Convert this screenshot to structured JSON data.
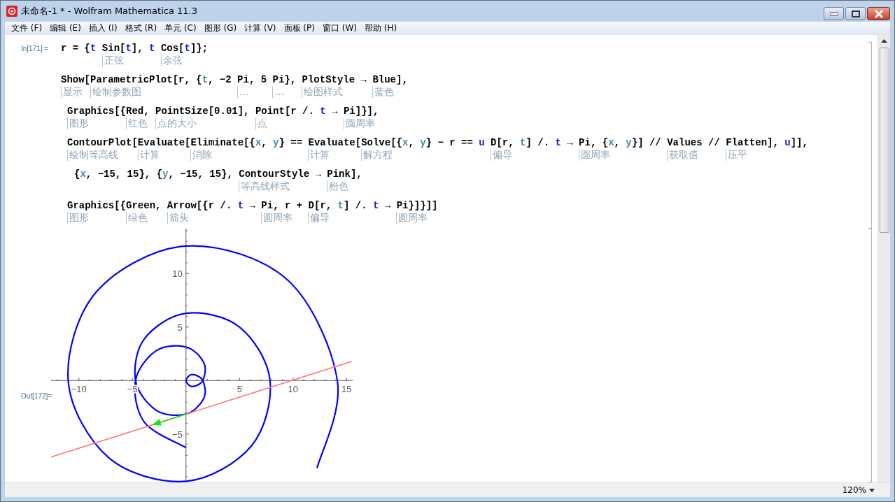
{
  "window": {
    "title": "未命名-1 * - Wolfram Mathematica 11.3"
  },
  "menu": [
    {
      "label": "文件 (F)"
    },
    {
      "label": "编辑 (E)"
    },
    {
      "label": "插入 (I)"
    },
    {
      "label": "格式 (R)"
    },
    {
      "label": "单元 (C)"
    },
    {
      "label": "图形 (G)"
    },
    {
      "label": "计算 (V)"
    },
    {
      "label": "面板 (P)"
    },
    {
      "label": "窗口 (W)"
    },
    {
      "label": "帮助 (H)"
    }
  ],
  "input_cell": {
    "label": "In[171]:=",
    "lines": [
      {
        "kind": "statement",
        "tokens": [
          {
            "text": "r = {",
            "kind": "sym"
          },
          {
            "text": "t ",
            "kind": "local"
          },
          {
            "text": "Sin[",
            "kind": "sym",
            "hint": "正弦"
          },
          {
            "text": "t",
            "kind": "local"
          },
          {
            "text": "], ",
            "kind": "sym"
          },
          {
            "text": "t ",
            "kind": "local"
          },
          {
            "text": "Cos[",
            "kind": "sym",
            "hint": "余弦"
          },
          {
            "text": "t",
            "kind": "local"
          },
          {
            "text": "]};",
            "kind": "sym"
          }
        ]
      },
      {
        "kind": "statement",
        "tokens": [
          {
            "text": "Show[",
            "kind": "sym",
            "hint": "显示"
          },
          {
            "text": "ParametricPlot[",
            "kind": "sym",
            "hint": "绘制参数图"
          },
          {
            "text": "r, {",
            "kind": "sym"
          },
          {
            "text": "t",
            "kind": "arg"
          },
          {
            "text": ", −2 ",
            "kind": "sym"
          },
          {
            "text": "Pi",
            "kind": "sym",
            "hint": "…"
          },
          {
            "text": ", 5 ",
            "kind": "sym"
          },
          {
            "text": "Pi",
            "kind": "sym",
            "hint": "…"
          },
          {
            "text": "}, ",
            "kind": "sym"
          },
          {
            "text": "PlotStyle",
            "kind": "sym",
            "hint": "绘图样式"
          },
          {
            "text": " → ",
            "kind": "sym"
          },
          {
            "text": "Blue",
            "kind": "sym",
            "hint": "蓝色"
          },
          {
            "text": "],",
            "kind": "sym"
          }
        ]
      },
      {
        "kind": "argument",
        "tokens": [
          {
            "text": "Graphics[",
            "kind": "sym",
            "hint": "图形"
          },
          {
            "text": "{",
            "kind": "sym"
          },
          {
            "text": "Red",
            "kind": "sym",
            "hint": "红色"
          },
          {
            "text": ", ",
            "kind": "sym"
          },
          {
            "text": "PointSize[",
            "kind": "sym",
            "hint": "点的大小"
          },
          {
            "text": "0.01], ",
            "kind": "sym"
          },
          {
            "text": "Point[",
            "kind": "sym",
            "hint": "点"
          },
          {
            "text": "r /. ",
            "kind": "sym"
          },
          {
            "text": "t",
            "kind": "local"
          },
          {
            "text": " → ",
            "kind": "sym"
          },
          {
            "text": "Pi",
            "kind": "sym",
            "hint": "圆周率"
          },
          {
            "text": "]}],",
            "kind": "sym"
          }
        ]
      },
      {
        "kind": "argument",
        "tokens": [
          {
            "text": "ContourPlot[",
            "kind": "sym",
            "hint": "绘制等高线"
          },
          {
            "text": "Evaluate[",
            "kind": "sym",
            "hint": "计算"
          },
          {
            "text": "Eliminate[",
            "kind": "sym",
            "hint": "消除"
          },
          {
            "text": "{",
            "kind": "sym"
          },
          {
            "text": "x",
            "kind": "arg"
          },
          {
            "text": ", ",
            "kind": "sym"
          },
          {
            "text": "y",
            "kind": "arg"
          },
          {
            "text": "} == ",
            "kind": "sym"
          },
          {
            "text": "Evaluate[",
            "kind": "sym",
            "hint": "计算"
          },
          {
            "text": "Solve[",
            "kind": "sym",
            "hint": "解方程"
          },
          {
            "text": "{",
            "kind": "sym"
          },
          {
            "text": "x",
            "kind": "arg"
          },
          {
            "text": ", ",
            "kind": "sym"
          },
          {
            "text": "y",
            "kind": "arg"
          },
          {
            "text": "} − r == ",
            "kind": "sym"
          },
          {
            "text": "u ",
            "kind": "local"
          },
          {
            "text": "D[",
            "kind": "sym",
            "hint": "偏导"
          },
          {
            "text": "r, ",
            "kind": "sym"
          },
          {
            "text": "t",
            "kind": "arg"
          },
          {
            "text": "] /. ",
            "kind": "sym"
          },
          {
            "text": "t",
            "kind": "local"
          },
          {
            "text": " → ",
            "kind": "sym"
          },
          {
            "text": "Pi",
            "kind": "sym",
            "hint": "圆周率"
          },
          {
            "text": ", {",
            "kind": "sym"
          },
          {
            "text": "x",
            "kind": "arg"
          },
          {
            "text": ", ",
            "kind": "sym"
          },
          {
            "text": "y",
            "kind": "arg"
          },
          {
            "text": "}] // ",
            "kind": "sym"
          },
          {
            "text": "Values",
            "kind": "sym",
            "hint": "获取值"
          },
          {
            "text": " // ",
            "kind": "sym"
          },
          {
            "text": "Flatten",
            "kind": "sym",
            "hint": "压平"
          },
          {
            "text": "], ",
            "kind": "sym"
          },
          {
            "text": "u",
            "kind": "local"
          },
          {
            "text": "]],",
            "kind": "sym"
          }
        ]
      },
      {
        "kind": "nested",
        "tokens": [
          {
            "text": "{",
            "kind": "sym"
          },
          {
            "text": "x",
            "kind": "arg"
          },
          {
            "text": ", −15, 15}, {",
            "kind": "sym"
          },
          {
            "text": "y",
            "kind": "arg"
          },
          {
            "text": ", −15, 15}, ",
            "kind": "sym"
          },
          {
            "text": "ContourStyle",
            "kind": "sym",
            "hint": "等高线样式"
          },
          {
            "text": " → ",
            "kind": "sym"
          },
          {
            "text": "Pink",
            "kind": "sym",
            "hint": "粉色"
          },
          {
            "text": "],",
            "kind": "sym"
          }
        ]
      },
      {
        "kind": "argument",
        "tokens": [
          {
            "text": "Graphics[",
            "kind": "sym",
            "hint": "图形"
          },
          {
            "text": "{",
            "kind": "sym"
          },
          {
            "text": "Green",
            "kind": "sym",
            "hint": "绿色"
          },
          {
            "text": ", ",
            "kind": "sym"
          },
          {
            "text": "Arrow[",
            "kind": "sym",
            "hint": "箭头"
          },
          {
            "text": "{r /. ",
            "kind": "sym"
          },
          {
            "text": "t",
            "kind": "local"
          },
          {
            "text": " → ",
            "kind": "sym"
          },
          {
            "text": "Pi",
            "kind": "sym",
            "hint": "圆周率"
          },
          {
            "text": ", r + ",
            "kind": "sym"
          },
          {
            "text": "D[",
            "kind": "sym",
            "hint": "偏导"
          },
          {
            "text": "r, ",
            "kind": "sym"
          },
          {
            "text": "t",
            "kind": "arg"
          },
          {
            "text": "] /. ",
            "kind": "sym"
          },
          {
            "text": "t",
            "kind": "local"
          },
          {
            "text": " → ",
            "kind": "sym"
          },
          {
            "text": "Pi",
            "kind": "sym",
            "hint": "圆周率"
          },
          {
            "text": "}]}]]",
            "kind": "sym"
          }
        ]
      }
    ]
  },
  "output_cell": {
    "label": "Out[172]=",
    "chart_data": {
      "type": "line",
      "xlim": [
        -12.6,
        15.6
      ],
      "ylim": [
        -9.5,
        14.2
      ],
      "xticks": [
        {
          "value": -10,
          "label": "−10"
        },
        {
          "value": -5,
          "label": "−5"
        },
        {
          "value": 5,
          "label": "5"
        },
        {
          "value": 10,
          "label": "10"
        },
        {
          "value": 15,
          "label": "15"
        }
      ],
      "yticks": [
        {
          "value": -5,
          "label": "−5"
        },
        {
          "value": 5,
          "label": "5"
        },
        {
          "value": 10,
          "label": "10"
        }
      ],
      "series": [
        {
          "color": "#0000ff",
          "x": [
            0,
            -3.89,
            -4.71,
            -2.78,
            0,
            1.67,
            1.57,
            0.56,
            0,
            0.56,
            1.57,
            1.67,
            0,
            -2.78,
            -4.71,
            -3.89,
            0,
            5.0,
            7.85,
            6.11,
            0,
            -7.22,
            -11.0,
            -8.33,
            0,
            9.44,
            14.14,
            12.24
          ],
          "values": [
            -6.28,
            -3.89,
            0,
            2.78,
            3.14,
            1.67,
            0,
            -0.56,
            0,
            0.56,
            0,
            -1.67,
            -3.14,
            -2.78,
            0,
            3.89,
            6.28,
            5.0,
            0,
            -6.11,
            -9.42,
            -7.22,
            0,
            8.33,
            12.57,
            9.44,
            0,
            -8.19
          ]
        },
        {
          "color": "#ff8080",
          "x": [
            -12.6,
            15.5
          ],
          "values": [
            -7.15,
            1.79
          ]
        },
        {
          "color": "#00ee00",
          "x": [
            0,
            -3.14
          ],
          "values": [
            -3.14,
            -4.14
          ]
        }
      ]
    }
  },
  "status_bar": {
    "zoom": "120%"
  }
}
